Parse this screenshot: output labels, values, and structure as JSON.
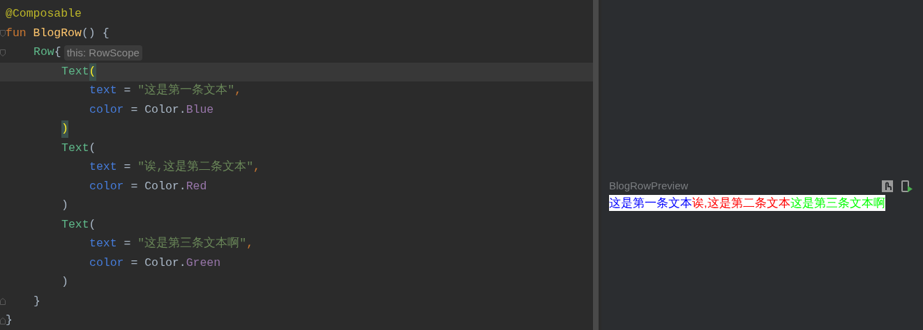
{
  "editor": {
    "lines": [
      {
        "current": false,
        "kind": "plain",
        "tokens": [
          {
            "kind": "annotation",
            "text": "@Composable"
          }
        ]
      },
      {
        "current": false,
        "kind": "fold-start",
        "tokens": [
          {
            "kind": "keyword",
            "text": "fun "
          },
          {
            "kind": "function",
            "text": "BlogRow"
          },
          {
            "kind": "plain",
            "text": "() {"
          }
        ],
        "children": [
          {
            "current": false,
            "kind": "fold-start",
            "tokens": [
              {
                "kind": "call",
                "text": "Row"
              },
              {
                "kind": "plain",
                "text": "{"
              },
              {
                "kind": "hint",
                "text": "this: RowScope"
              }
            ],
            "children": [
              {
                "current": true,
                "kind": "plain",
                "tokens": [
                  {
                    "kind": "call",
                    "text": "Text"
                  },
                  {
                    "kind": "bracket-match",
                    "text": "("
                  }
                ],
                "children": [
                  {
                    "current": false,
                    "kind": "plain",
                    "tokens": [
                      {
                        "kind": "param",
                        "text": "text"
                      },
                      {
                        "kind": "plain",
                        "text": " = "
                      },
                      {
                        "kind": "string",
                        "text": "\"这是第一条文本\""
                      },
                      {
                        "kind": "punct",
                        "text": ","
                      }
                    ]
                  },
                  {
                    "current": false,
                    "kind": "plain",
                    "tokens": [
                      {
                        "kind": "param",
                        "text": "color"
                      },
                      {
                        "kind": "plain",
                        "text": " = Color."
                      },
                      {
                        "kind": "constant",
                        "text": "Blue"
                      }
                    ]
                  }
                ]
              },
              {
                "current": false,
                "kind": "plain",
                "tokens": [
                  {
                    "kind": "bracket-match",
                    "text": ")"
                  }
                ]
              },
              {
                "current": false,
                "kind": "plain",
                "tokens": [
                  {
                    "kind": "call",
                    "text": "Text"
                  },
                  {
                    "kind": "plain",
                    "text": "("
                  }
                ],
                "children": [
                  {
                    "current": false,
                    "kind": "plain",
                    "tokens": [
                      {
                        "kind": "param",
                        "text": "text"
                      },
                      {
                        "kind": "plain",
                        "text": " = "
                      },
                      {
                        "kind": "string",
                        "text": "\"诶,这是第二条文本\""
                      },
                      {
                        "kind": "punct",
                        "text": ","
                      }
                    ]
                  },
                  {
                    "current": false,
                    "kind": "plain",
                    "tokens": [
                      {
                        "kind": "param",
                        "text": "color"
                      },
                      {
                        "kind": "plain",
                        "text": " = Color."
                      },
                      {
                        "kind": "constant",
                        "text": "Red"
                      }
                    ]
                  }
                ]
              },
              {
                "current": false,
                "kind": "plain",
                "tokens": [
                  {
                    "kind": "plain",
                    "text": ")"
                  }
                ]
              },
              {
                "current": false,
                "kind": "plain",
                "tokens": [
                  {
                    "kind": "call",
                    "text": "Text"
                  },
                  {
                    "kind": "plain",
                    "text": "("
                  }
                ],
                "children": [
                  {
                    "current": false,
                    "kind": "plain",
                    "tokens": [
                      {
                        "kind": "param",
                        "text": "text"
                      },
                      {
                        "kind": "plain",
                        "text": " = "
                      },
                      {
                        "kind": "string",
                        "text": "\"这是第三条文本啊\""
                      },
                      {
                        "kind": "punct",
                        "text": ","
                      }
                    ]
                  },
                  {
                    "current": false,
                    "kind": "plain",
                    "tokens": [
                      {
                        "kind": "param",
                        "text": "color"
                      },
                      {
                        "kind": "plain",
                        "text": " = Color."
                      },
                      {
                        "kind": "constant",
                        "text": "Green"
                      }
                    ]
                  }
                ]
              },
              {
                "current": false,
                "kind": "plain",
                "tokens": [
                  {
                    "kind": "plain",
                    "text": ")"
                  }
                ]
              }
            ]
          },
          {
            "current": false,
            "kind": "fold-end",
            "tokens": [
              {
                "kind": "plain",
                "text": "}"
              }
            ]
          }
        ]
      },
      {
        "current": false,
        "kind": "fold-end",
        "tokens": [
          {
            "kind": "plain",
            "text": "}"
          }
        ]
      }
    ]
  },
  "preview": {
    "title": "BlogRowPreview",
    "segments": [
      {
        "text": "这是第一条文本",
        "color": "#0000ff"
      },
      {
        "text": "诶,这是第二条文本",
        "color": "#ff0000"
      },
      {
        "text": "这是第三条文本啊",
        "color": "#00ff00"
      }
    ]
  }
}
